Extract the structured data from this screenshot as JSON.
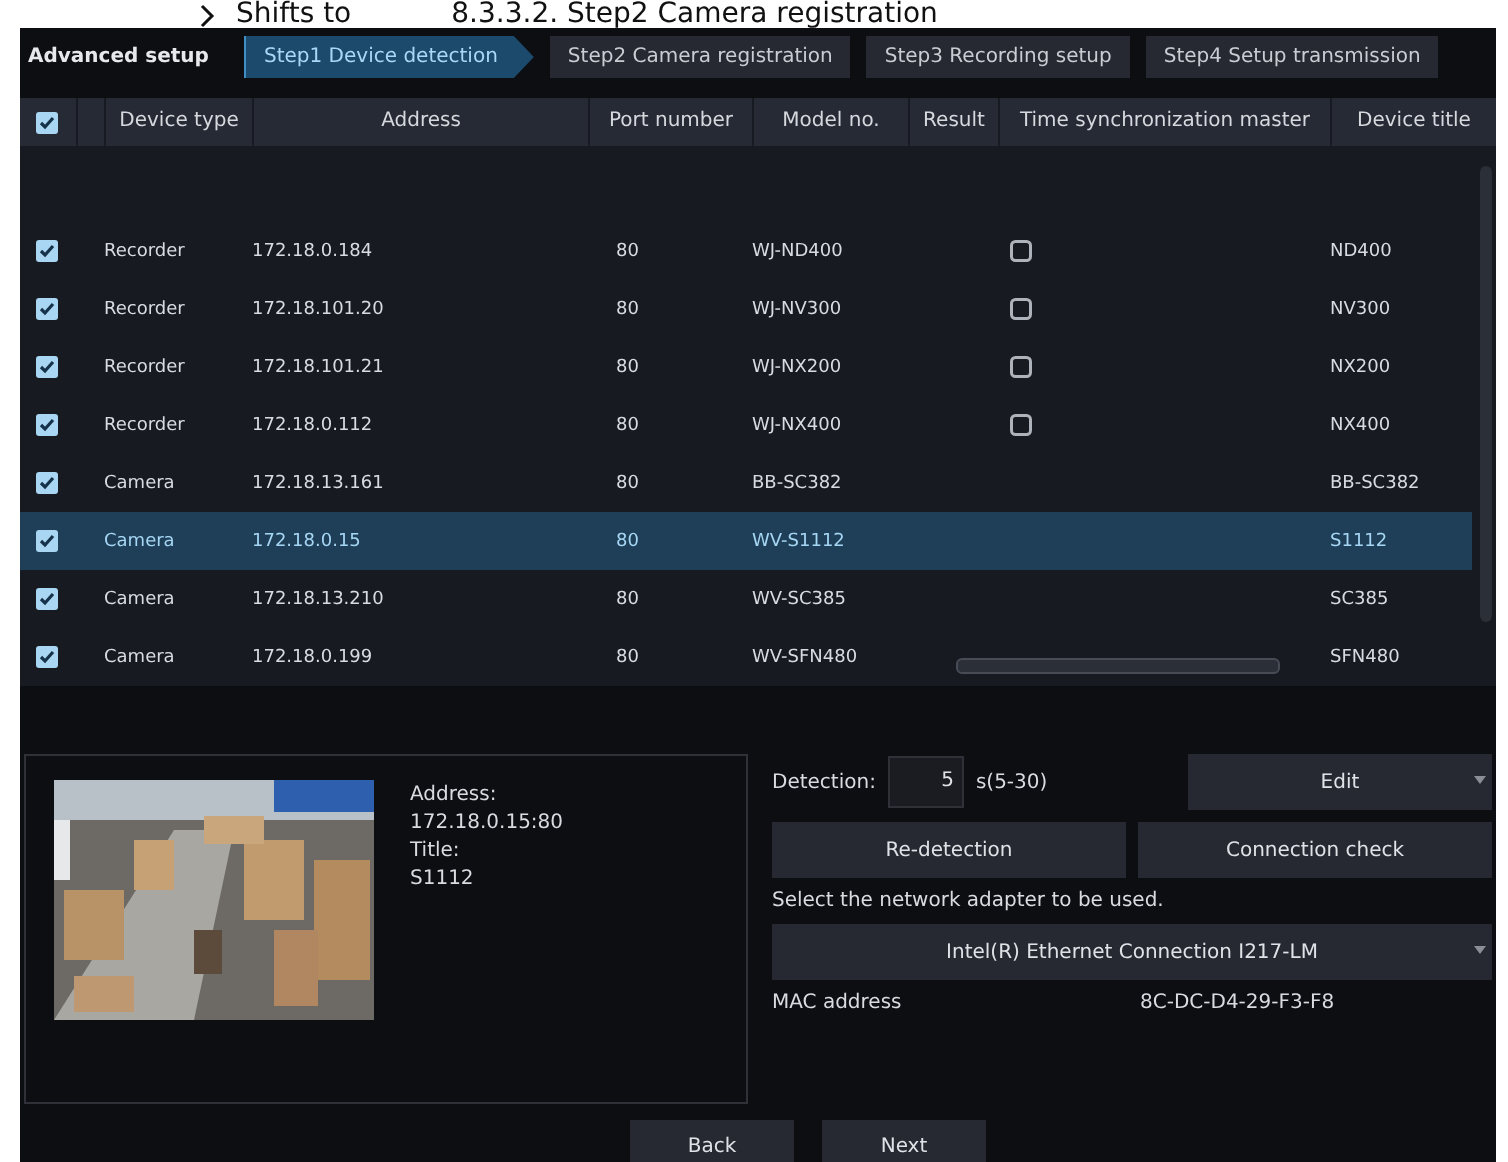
{
  "header": {
    "prefix": "Shifts to",
    "link": "8.3.3.2. Step2 Camera registration"
  },
  "title": "Advanced setup",
  "steps": [
    {
      "label": "Step1 Device detection",
      "selected": true
    },
    {
      "label": "Step2 Camera registration",
      "selected": false
    },
    {
      "label": "Step3 Recording setup",
      "selected": false
    },
    {
      "label": "Step4 Setup transmission",
      "selected": false
    }
  ],
  "table": {
    "all_checked": true,
    "columns": [
      "Device type",
      "Address",
      "Port number",
      "Model no.",
      "Result",
      "Time synchronization master",
      "Device title"
    ],
    "rows": [
      {
        "checked": true,
        "selected": false,
        "device_type": "Recorder",
        "address": "172.18.0.184",
        "port": "80",
        "model": "WJ-ND400",
        "time_sync": false,
        "title": "ND400"
      },
      {
        "checked": true,
        "selected": false,
        "device_type": "Recorder",
        "address": "172.18.101.20",
        "port": "80",
        "model": "WJ-NV300",
        "time_sync": false,
        "title": "NV300"
      },
      {
        "checked": true,
        "selected": false,
        "device_type": "Recorder",
        "address": "172.18.101.21",
        "port": "80",
        "model": "WJ-NX200",
        "time_sync": false,
        "title": "NX200"
      },
      {
        "checked": true,
        "selected": false,
        "device_type": "Recorder",
        "address": "172.18.0.112",
        "port": "80",
        "model": "WJ-NX400",
        "time_sync": false,
        "title": "NX400"
      },
      {
        "checked": true,
        "selected": false,
        "device_type": "Camera",
        "address": "172.18.13.161",
        "port": "80",
        "model": "BB-SC382",
        "title": "BB-SC382"
      },
      {
        "checked": true,
        "selected": true,
        "device_type": "Camera",
        "address": "172.18.0.15",
        "port": "80",
        "model": "WV-S1112",
        "title": "S1112"
      },
      {
        "checked": true,
        "selected": false,
        "device_type": "Camera",
        "address": "172.18.13.210",
        "port": "80",
        "model": "WV-SC385",
        "title": "SC385"
      },
      {
        "checked": true,
        "selected": false,
        "device_type": "Camera",
        "address": "172.18.0.199",
        "port": "80",
        "model": "WV-SFN480",
        "title": "SFN480"
      }
    ]
  },
  "detail": {
    "address_label": "Address:",
    "address": "172.18.0.15:80",
    "title_label": "Title:",
    "title": "S1112"
  },
  "controls": {
    "detection_label": "Detection:",
    "detection_value": "5",
    "detection_range": "s(5-30)",
    "edit": "Edit",
    "redetect": "Re-detection",
    "connection_check": "Connection check",
    "adapter_prompt": "Select the network adapter to be used.",
    "adapter": "Intel(R) Ethernet Connection I217-LM",
    "mac_label": "MAC address",
    "mac": "8C-DC-D4-29-F3-F8"
  },
  "buttons": [
    "Back",
    "Next"
  ]
}
